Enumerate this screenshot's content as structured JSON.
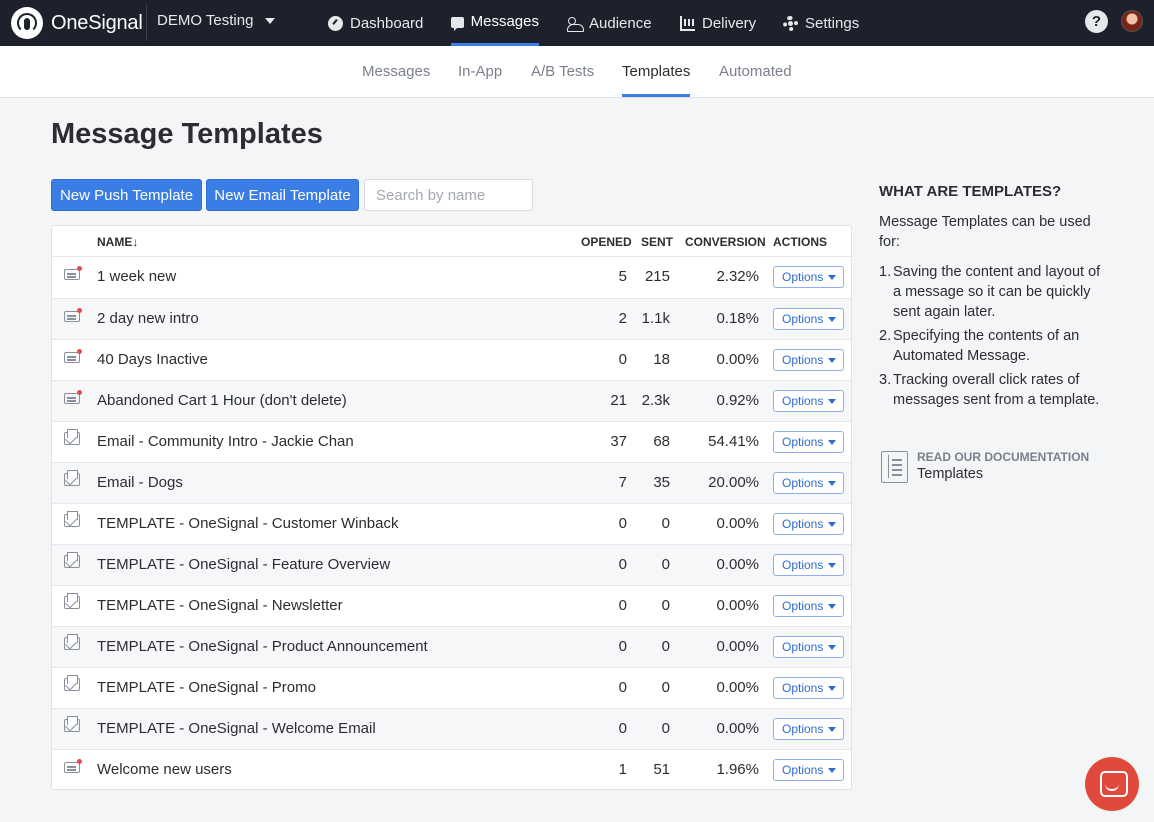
{
  "brand": {
    "name": "OneSignal",
    "accent": "#3a7de5",
    "nav_bg": "#1c212b"
  },
  "app_selector": {
    "label": "DEMO Testing"
  },
  "topnav": {
    "dashboard": "Dashboard",
    "messages": "Messages",
    "audience": "Audience",
    "delivery": "Delivery",
    "settings": "Settings",
    "help": "?"
  },
  "subnav": {
    "messages": "Messages",
    "in_app": "In-App",
    "ab_tests": "A/B Tests",
    "templates": "Templates",
    "automated": "Automated",
    "active": "Templates"
  },
  "page": {
    "title": "Message Templates"
  },
  "toolbar": {
    "new_push": "New Push Template",
    "new_email": "New Email Template",
    "search_placeholder": "Search by name"
  },
  "table": {
    "headers": {
      "name": "NAME↓",
      "opened": "OPENED",
      "sent": "SENT",
      "conversion": "CONVERSION",
      "actions": "ACTIONS"
    },
    "options_label": "Options",
    "rows": [
      {
        "type": "push",
        "name": "1 week new",
        "opened": "5",
        "sent": "215",
        "conversion": "2.32%"
      },
      {
        "type": "push",
        "name": "2 day new intro",
        "opened": "2",
        "sent": "1.1k",
        "conversion": "0.18%"
      },
      {
        "type": "push",
        "name": "40 Days Inactive",
        "opened": "0",
        "sent": "18",
        "conversion": "0.00%"
      },
      {
        "type": "push",
        "name": "Abandoned Cart 1 Hour (don't delete)",
        "opened": "21",
        "sent": "2.3k",
        "conversion": "0.92%"
      },
      {
        "type": "email",
        "name": "Email - Community Intro - Jackie Chan",
        "opened": "37",
        "sent": "68",
        "conversion": "54.41%"
      },
      {
        "type": "email",
        "name": "Email - Dogs",
        "opened": "7",
        "sent": "35",
        "conversion": "20.00%"
      },
      {
        "type": "email",
        "name": "TEMPLATE - OneSignal - Customer Winback",
        "opened": "0",
        "sent": "0",
        "conversion": "0.00%"
      },
      {
        "type": "email",
        "name": "TEMPLATE - OneSignal - Feature Overview",
        "opened": "0",
        "sent": "0",
        "conversion": "0.00%"
      },
      {
        "type": "email",
        "name": "TEMPLATE - OneSignal - Newsletter",
        "opened": "0",
        "sent": "0",
        "conversion": "0.00%"
      },
      {
        "type": "email",
        "name": "TEMPLATE - OneSignal - Product Announcement",
        "opened": "0",
        "sent": "0",
        "conversion": "0.00%"
      },
      {
        "type": "email",
        "name": "TEMPLATE - OneSignal - Promo",
        "opened": "0",
        "sent": "0",
        "conversion": "0.00%"
      },
      {
        "type": "email",
        "name": "TEMPLATE - OneSignal - Welcome Email",
        "opened": "0",
        "sent": "0",
        "conversion": "0.00%"
      },
      {
        "type": "push",
        "name": "Welcome new users",
        "opened": "1",
        "sent": "51",
        "conversion": "1.96%"
      }
    ]
  },
  "sidebar": {
    "title": "WHAT ARE TEMPLATES?",
    "intro": "Message Templates can be used for:",
    "items": [
      {
        "num": "1.",
        "text": "Saving the content and layout of a message so it can be quickly sent again later."
      },
      {
        "num": "2.",
        "text": "Specifying the contents of an Automated Message."
      },
      {
        "num": "3.",
        "text": "Tracking overall click rates of messages sent from a template."
      }
    ],
    "doc_label": "READ OUR DOCUMENTATION",
    "doc_link": "Templates"
  }
}
